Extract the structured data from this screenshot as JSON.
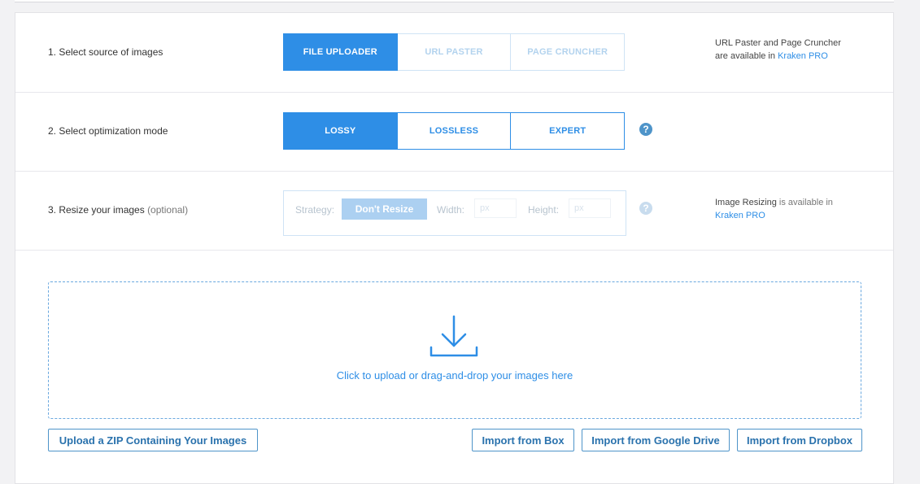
{
  "step1": {
    "label": "1. Select source of images",
    "options": [
      "FILE UPLOADER",
      "URL PASTER",
      "PAGE CRUNCHER"
    ],
    "note_line1": "URL Paster and Page Cruncher",
    "note_line2_prefix": "are available in",
    "note_link": "Kraken PRO"
  },
  "step2": {
    "label": "2. Select optimization mode",
    "options": [
      "LOSSY",
      "LOSSLESS",
      "EXPERT"
    ],
    "help_glyph": "?"
  },
  "step3": {
    "label": "3. Resize your images",
    "label_optional": "(optional)",
    "strategy_label": "Strategy:",
    "strategy_value": "Don't Resize",
    "width_label": "Width:",
    "width_unit": "px",
    "height_label": "Height:",
    "height_unit": "px",
    "help_glyph": "?",
    "note_bold": "Image Resizing",
    "note_rest": "is available in",
    "note_link": "Kraken PRO"
  },
  "dropzone": {
    "text": "Click to upload or drag-and-drop your images here",
    "icon": "download-arrow-icon"
  },
  "buttons": {
    "zip": "Upload a ZIP Containing Your Images",
    "box": "Import from Box",
    "gdrive": "Import from Google Drive",
    "dropbox": "Import from Dropbox"
  },
  "colors": {
    "accent": "#2e8ee6",
    "disabled": "#b3d3ee",
    "help_active": "#4e94c9",
    "help_disabled": "#c8dcee"
  }
}
